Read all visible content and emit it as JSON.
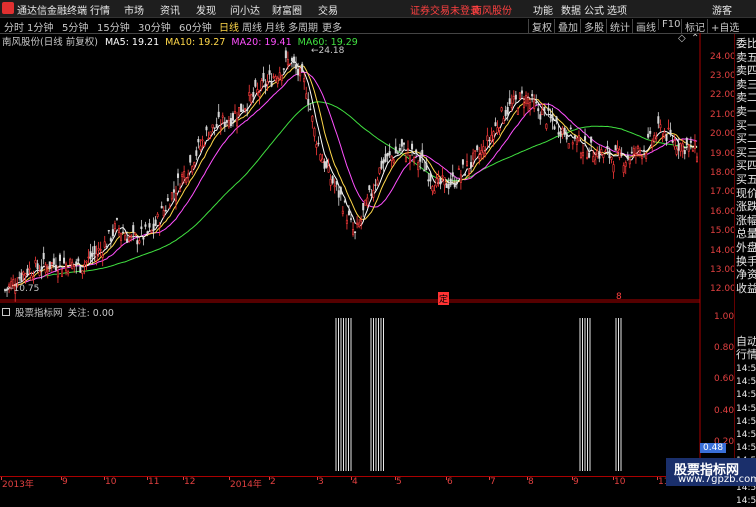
{
  "app": {
    "title": "通达信金融终端",
    "menu": [
      "行情",
      "市场",
      "资讯",
      "发现",
      "问小达",
      "财富圈",
      "交易"
    ],
    "notice": "证券交易未登录",
    "stock_link": "南风股份",
    "right_menu": [
      "功能",
      "数据",
      "公式",
      "选项",
      "游客"
    ]
  },
  "periods": {
    "items": [
      "分时",
      "1分钟",
      "5分钟",
      "15分钟",
      "30分钟",
      "60分钟",
      "日线",
      "周线",
      "月线",
      "多周期",
      "更多"
    ],
    "active": "日线"
  },
  "toolbar": [
    "复权",
    "叠加",
    "多股",
    "统计",
    "画线",
    "F10",
    "标记",
    "+自选"
  ],
  "legend": {
    "name": "南风股份(日线 前复权)",
    "ma5": "MA5: 19.21",
    "ma10": "MA10: 19.27",
    "ma20": "MA20: 19.41",
    "ma60": "MA60: 19.29"
  },
  "colors": {
    "up": "#ff3b3b",
    "down": "#d8d8d8",
    "ma5": "#ffffff",
    "ma10": "#ffd84a",
    "ma20": "#ff50ff",
    "ma60": "#40e040",
    "axis": "#e04040",
    "indicator_value": "#3a6fd8"
  },
  "price_axis": {
    "ticks": [
      "24.00",
      "23.00",
      "22.00",
      "21.00",
      "20.00",
      "19.00",
      "18.00",
      "17.00",
      "16.00",
      "15.00",
      "14.00",
      "13.00",
      "12.00"
    ],
    "min": 11.5,
    "max": 24.5
  },
  "annotations": {
    "high": "24.18",
    "low": "10.75",
    "high_value": 24.18,
    "low_value": 10.75
  },
  "markers": [
    "定",
    "8"
  ],
  "indicator": {
    "title": "股票指标网",
    "subtitle": "关注: 0.00",
    "ticks": [
      "1.00",
      "0.80",
      "0.60",
      "0.40",
      "0.20",
      "0.00"
    ],
    "current": "0.48"
  },
  "right_panel": {
    "top_labels": [
      "委比",
      "卖五",
      "卖四",
      "卖三",
      "卖二",
      "卖一",
      "买一",
      "买二",
      "买三",
      "买四",
      "买五",
      "现价",
      "涨跌",
      "涨幅",
      "总量",
      "外盘",
      "换手",
      "净资",
      "收益"
    ],
    "tick_header": [
      "自动",
      "行情"
    ],
    "tick_times": [
      "14:50",
      "14:50",
      "14:50",
      "14:50",
      "14:50",
      "14:50",
      "14:50",
      "14:50",
      "14:50",
      "14:50",
      "14:50"
    ]
  },
  "time_axis": [
    "2013年",
    "9",
    "10",
    "11",
    "12",
    "2014年",
    "2",
    "3",
    "4",
    "5",
    "6",
    "7",
    "8",
    "9",
    "10",
    "11"
  ],
  "watermark": {
    "line1": "股票指标网",
    "line2": "www.7gpzb.com"
  }
}
